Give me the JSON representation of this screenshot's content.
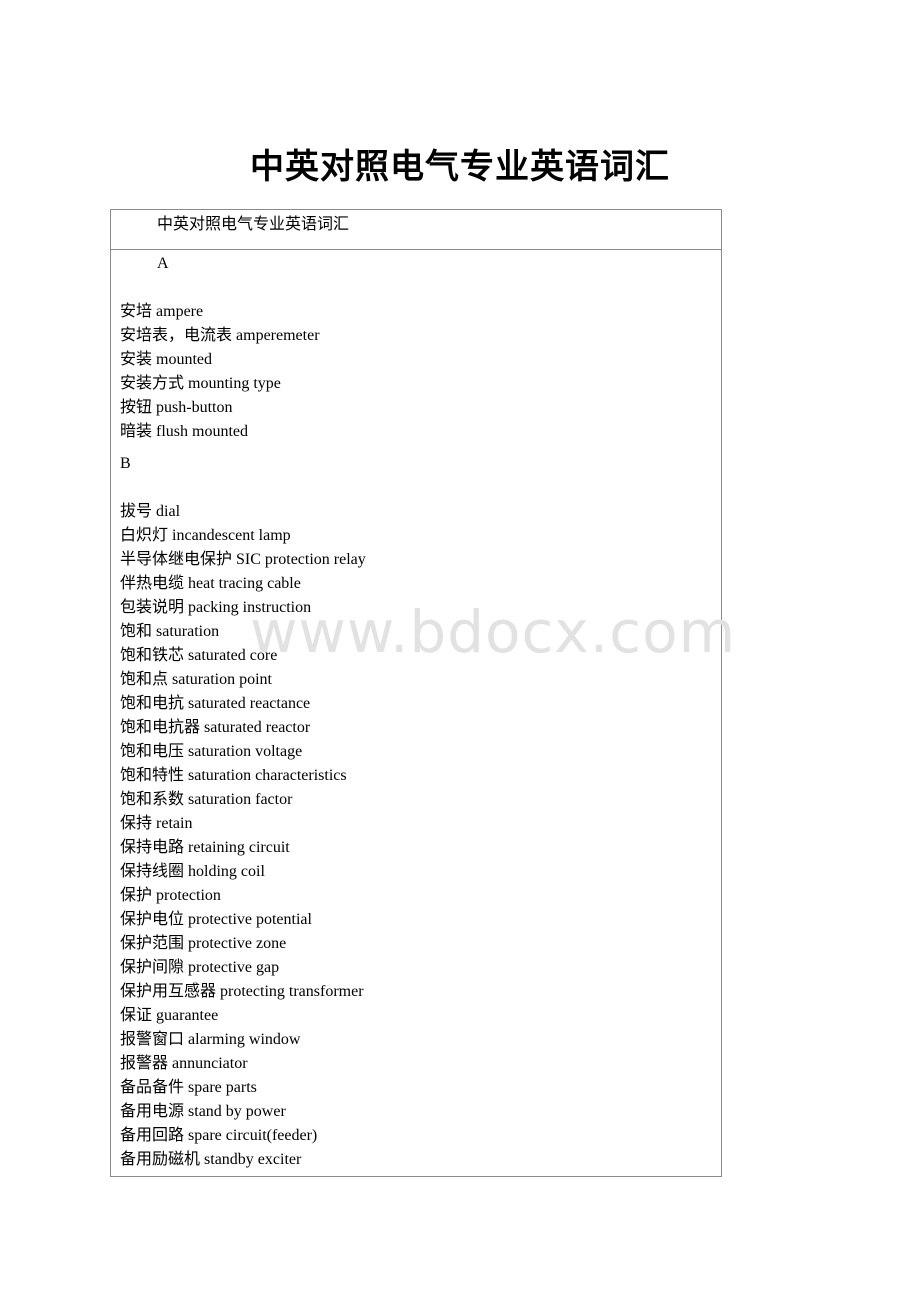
{
  "document": {
    "title": "中英对照电气专业英语词汇",
    "header_cell": "中英对照电气专业英语词汇",
    "watermark": "www.bdocx.com"
  },
  "sections": [
    {
      "letter": "A",
      "entries": [
        {
          "zh": "安培",
          "en": "ampere"
        },
        {
          "zh": "安培表，电流表",
          "en": "amperemeter"
        },
        {
          "zh": "安装",
          "en": "mounted"
        },
        {
          "zh": "安装方式",
          "en": "mounting type"
        },
        {
          "zh": "按钮",
          "en": "push-button"
        },
        {
          "zh": "暗装",
          "en": "flush mounted"
        }
      ]
    },
    {
      "letter": "B",
      "entries": [
        {
          "zh": "拔号",
          "en": "dial"
        },
        {
          "zh": "白炽灯",
          "en": "incandescent lamp"
        },
        {
          "zh": "半导体继电保护",
          "en": "SIC protection relay"
        },
        {
          "zh": "伴热电缆",
          "en": "heat tracing cable"
        },
        {
          "zh": "包装说明",
          "en": "packing instruction"
        },
        {
          "zh": "饱和",
          "en": "saturation"
        },
        {
          "zh": "饱和铁芯",
          "en": "saturated core"
        },
        {
          "zh": "饱和点",
          "en": "saturation point"
        },
        {
          "zh": "饱和电抗",
          "en": "saturated reactance"
        },
        {
          "zh": "饱和电抗器",
          "en": "saturated reactor"
        },
        {
          "zh": "饱和电压",
          "en": "saturation voltage"
        },
        {
          "zh": "饱和特性",
          "en": "saturation characteristics"
        },
        {
          "zh": "饱和系数",
          "en": "saturation factor"
        },
        {
          "zh": "保持",
          "en": "retain"
        },
        {
          "zh": "保持电路",
          "en": "retaining circuit"
        },
        {
          "zh": "保持线圈",
          "en": "holding coil"
        },
        {
          "zh": "保护",
          "en": "protection"
        },
        {
          "zh": "保护电位",
          "en": "protective potential"
        },
        {
          "zh": "保护范围",
          "en": "protective zone"
        },
        {
          "zh": "保护间隙",
          "en": "protective gap"
        },
        {
          "zh": "保护用互感器",
          "en": "protecting transformer"
        },
        {
          "zh": "保证",
          "en": "guarantee"
        },
        {
          "zh": "报警窗口",
          "en": "alarming window"
        },
        {
          "zh": "报警器",
          "en": "annunciator"
        },
        {
          "zh": "备品备件",
          "en": "spare parts"
        },
        {
          "zh": "备用电源",
          "en": "stand by power"
        },
        {
          "zh": "备用回路",
          "en": "spare circuit(feeder)"
        },
        {
          "zh": "备用励磁机",
          "en": "standby exciter"
        }
      ]
    }
  ]
}
